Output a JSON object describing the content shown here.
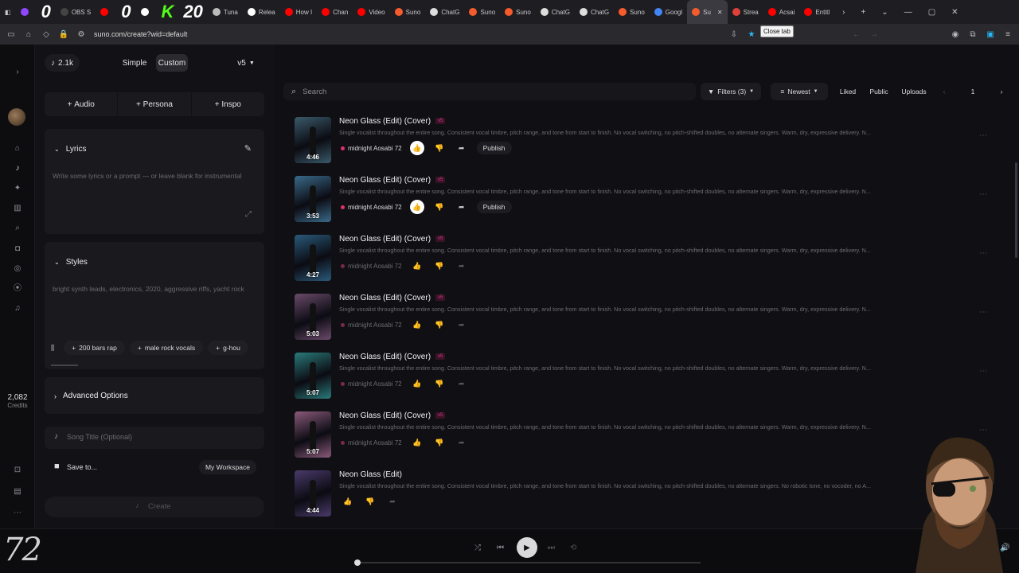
{
  "browser": {
    "tabs": [
      {
        "label": "",
        "icon": "twitch-icon",
        "color": "#9146ff"
      },
      {
        "label": "0",
        "icon": "text-0",
        "color": "#ffffff",
        "big": true
      },
      {
        "label": "OBS S",
        "icon": "obs-icon",
        "color": "#444"
      },
      {
        "label": "",
        "icon": "youtube-icon",
        "color": "#ff0000"
      },
      {
        "label": "0",
        "icon": "text-0",
        "color": "#ffffff",
        "big": true
      },
      {
        "label": "",
        "icon": "github-icon",
        "color": "#ffffff"
      },
      {
        "label": "K",
        "icon": "kick-icon",
        "color": "#53fc18",
        "big": true
      },
      {
        "label": "20",
        "icon": "text-20",
        "color": "#ffffff",
        "big": true
      },
      {
        "label": "Tuna",
        "icon": "clock-icon",
        "color": "#bbbbbb"
      },
      {
        "label": "Relea",
        "icon": "github-icon",
        "color": "#ffffff"
      },
      {
        "label": "How I",
        "icon": "youtube-icon",
        "color": "#ff0000"
      },
      {
        "label": "Chan",
        "icon": "youtube-icon",
        "color": "#ff0000"
      },
      {
        "label": "Video",
        "icon": "youtube-icon",
        "color": "#ff0000"
      },
      {
        "label": "Suno",
        "icon": "suno-icon",
        "color": "#f55b2c"
      },
      {
        "label": "ChatG",
        "icon": "chatgpt-icon",
        "color": "#dddddd"
      },
      {
        "label": "Suno",
        "icon": "s-icon",
        "color": "#f55b2c"
      },
      {
        "label": "Suno",
        "icon": "suno-icon",
        "color": "#f55b2c"
      },
      {
        "label": "ChatG",
        "icon": "chatgpt-icon",
        "color": "#dddddd"
      },
      {
        "label": "ChatG",
        "icon": "chatgpt-icon",
        "color": "#dddddd"
      },
      {
        "label": "Suno",
        "icon": "suno-icon",
        "color": "#f55b2c"
      },
      {
        "label": "Googl",
        "icon": "google-icon",
        "color": "#4285f4"
      },
      {
        "label": "Su",
        "icon": "suno-icon",
        "color": "#f55b2c",
        "active": true
      },
      {
        "label": "Strea",
        "icon": "stream-icon",
        "color": "#e0403a"
      },
      {
        "label": "Acsai",
        "icon": "youtube-icon",
        "color": "#ff0000"
      },
      {
        "label": "Entitl",
        "icon": "youtube-icon",
        "color": "#ff0000"
      }
    ],
    "url": "suno.com/create?wid=default",
    "tooltip": "Close tab"
  },
  "rail": {
    "credits": "2,082",
    "credits_label": "Credits"
  },
  "panel": {
    "count": "2.1k",
    "mode_simple": "Simple",
    "mode_custom": "Custom",
    "version": "v5",
    "btn_audio": "Audio",
    "btn_persona": "Persona",
    "btn_inspo": "Inspo",
    "lyrics_title": "Lyrics",
    "lyrics_placeholder": "Write some lyrics or a prompt — or leave blank for instrumental",
    "styles_title": "Styles",
    "styles_placeholder": "bright synth leads, electronics, 2020, aggressive riffs, yacht rock",
    "chips": [
      "200 bars rap",
      "male rock vocals",
      "g-hou"
    ],
    "advanced": "Advanced Options",
    "song_title_ph": "Song Title (Optional)",
    "save_to": "Save to...",
    "workspace": "My Workspace",
    "create": "Create"
  },
  "main": {
    "search_ph": "Search",
    "filters": "Filters (3)",
    "sort": "Newest",
    "liked": "Liked",
    "public": "Public",
    "uploads": "Uploads",
    "page": "1",
    "songs": [
      {
        "title": "Neon Glass (Edit) (Cover)",
        "badge": "v5",
        "desc": "Single vocalist throughout the entire song. Consistent vocal timbre, pitch range, and tone from start to finish. No vocal switching, no pitch-shifted doubles, no alternate singers. Warm, dry, expressive delivery. N...",
        "artist": "midnight Aosabi 72",
        "duration": "4:46",
        "publish": "Publish",
        "dim": false,
        "thumb": "#3a5a6a"
      },
      {
        "title": "Neon Glass (Edit) (Cover)",
        "badge": "v5",
        "desc": "Single vocalist throughout the entire song. Consistent vocal timbre, pitch range, and tone from start to finish. No vocal switching, no pitch-shifted doubles, no alternate singers. Warm, dry, expressive delivery. N...",
        "artist": "midnight Aosabi 72",
        "duration": "3:53",
        "publish": "Publish",
        "dim": false,
        "thumb": "#3a6a8a"
      },
      {
        "title": "Neon Glass (Edit) (Cover)",
        "badge": "v5",
        "desc": "Single vocalist throughout the entire song. Consistent vocal timbre, pitch range, and tone from start to finish. No vocal switching, no pitch-shifted doubles, no alternate singers. Warm, dry, expressive delivery. N...",
        "artist": "midnight Aosabi 72",
        "duration": "4:27",
        "publish": "",
        "dim": true,
        "thumb": "#2a5a7a"
      },
      {
        "title": "Neon Glass (Edit) (Cover)",
        "badge": "v5",
        "desc": "Single vocalist throughout the entire song. Consistent vocal timbre, pitch range, and tone from start to finish. No vocal switching, no pitch-shifted doubles, no alternate singers. Warm, dry, expressive delivery. N...",
        "artist": "midnight Aosabi 72",
        "duration": "5:03",
        "publish": "",
        "dim": true,
        "thumb": "#6a4a6a"
      },
      {
        "title": "Neon Glass (Edit) (Cover)",
        "badge": "v5",
        "desc": "Single vocalist throughout the entire song. Consistent vocal timbre, pitch range, and tone from start to finish. No vocal switching, no pitch-shifted doubles, no alternate singers. Warm, dry, expressive delivery. N...",
        "artist": "midnight Aosabi 72",
        "duration": "5:07",
        "publish": "",
        "dim": true,
        "thumb": "#2a7a7a"
      },
      {
        "title": "Neon Glass (Edit) (Cover)",
        "badge": "v5",
        "desc": "Single vocalist throughout the entire song. Consistent vocal timbre, pitch range, and tone from start to finish. No vocal switching, no pitch-shifted doubles, no alternate singers. Warm, dry, expressive delivery. N...",
        "artist": "midnight Aosabi 72",
        "duration": "5:07",
        "publish": "",
        "dim": true,
        "thumb": "#8a5a7a"
      },
      {
        "title": "Neon Glass (Edit)",
        "badge": "",
        "desc": "Single vocalist throughout the entire song. Consistent vocal timbre, pitch range, and tone from start to finish. No vocal switching, no pitch-shifted doubles, no alternate singers. No robotic tone, no vocoder, no A...",
        "artist": "",
        "duration": "4:44",
        "publish": "",
        "dim": true,
        "thumb": "#4a3a6a"
      }
    ]
  },
  "colors": {
    "accent": "#e0316a",
    "bg": "#101014",
    "panel": "#121216"
  }
}
